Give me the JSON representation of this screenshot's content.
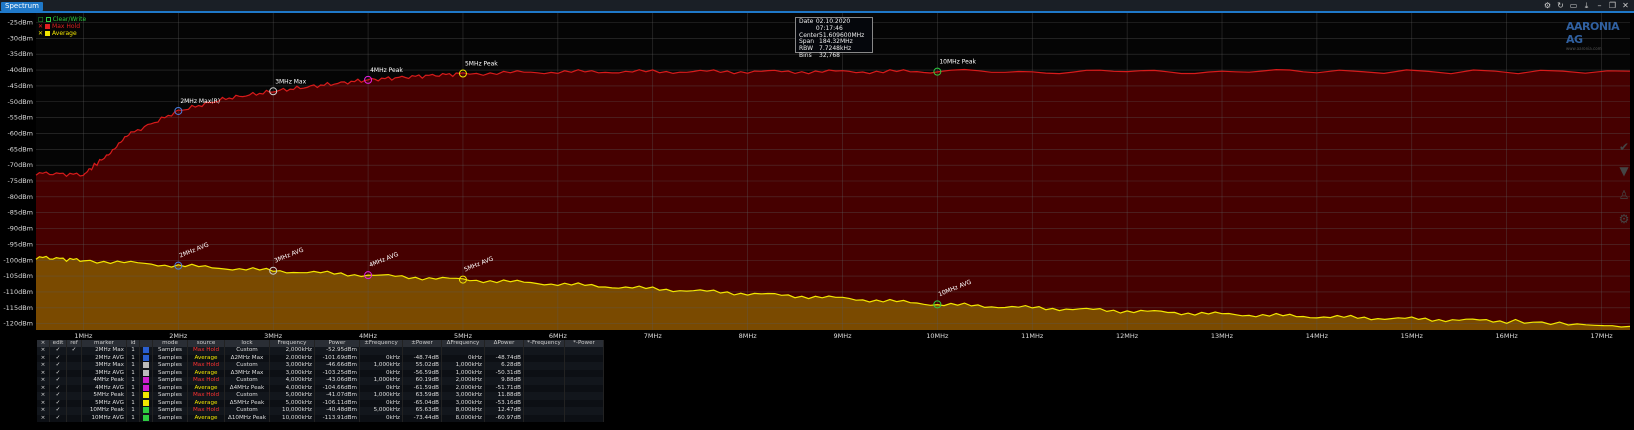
{
  "window": {
    "tab": "Spectrum",
    "icons": [
      "gear-icon",
      "refresh-icon",
      "layout-icon",
      "download-icon",
      "minimize-icon",
      "restore-icon",
      "close-icon"
    ]
  },
  "colors": {
    "maxhold": "#d81b1b",
    "average": "#f2e600",
    "bg_red": "#4a0000",
    "bg_avg": "#7a4a00",
    "accent": "#1f78c8"
  },
  "legend": [
    {
      "label": "Clear/Write",
      "color": "#2ecc40",
      "mark": "□"
    },
    {
      "label": "Max Hold",
      "color": "#e02020",
      "mark": "✕"
    },
    {
      "label": "Average",
      "color": "#f2e600",
      "mark": "✕"
    }
  ],
  "info": {
    "rows": [
      {
        "k": "Date",
        "v": "02.10.2020 07:17:46"
      },
      {
        "k": "Center",
        "v": "51.609600MHz"
      },
      {
        "k": "Span",
        "v": "184.32MHz"
      },
      {
        "k": "RBW",
        "v": "7.7248kHz"
      },
      {
        "k": "Bins",
        "v": "32,768"
      }
    ]
  },
  "logo": {
    "text": "AARONIA AG",
    "sub": "www.aaronia.com"
  },
  "chart_data": {
    "type": "line",
    "ylim": [
      -122,
      -22
    ],
    "xlim": [
      0.5,
      17.3
    ],
    "y_ticks": [
      "-25dBm",
      "-30dBm",
      "-35dBm",
      "-40dBm",
      "-45dBm",
      "-50dBm",
      "-55dBm",
      "-60dBm",
      "-65dBm",
      "-70dBm",
      "-75dBm",
      "-80dBm",
      "-85dBm",
      "-90dBm",
      "-95dBm",
      "-100dBm",
      "-105dBm",
      "-110dBm",
      "-115dBm",
      "-120dBm"
    ],
    "y_tick_values": [
      -25,
      -30,
      -35,
      -40,
      -45,
      -50,
      -55,
      -60,
      -65,
      -70,
      -75,
      -80,
      -85,
      -90,
      -95,
      -100,
      -105,
      -110,
      -115,
      -120
    ],
    "x_ticks": [
      "1MHz",
      "2MHz",
      "3MHz",
      "4MHz",
      "5MHz",
      "6MHz",
      "7MHz",
      "8MHz",
      "9MHz",
      "10MHz",
      "11MHz",
      "12MHz",
      "13MHz",
      "14MHz",
      "15MHz",
      "16MHz",
      "17MHz"
    ],
    "x_tick_values": [
      1,
      2,
      3,
      4,
      5,
      6,
      7,
      8,
      9,
      10,
      11,
      12,
      13,
      14,
      15,
      16,
      17
    ],
    "series": [
      {
        "name": "Max Hold",
        "x": [
          0.5,
          1.0,
          1.2,
          1.5,
          2.0,
          2.5,
          3.0,
          3.5,
          4.0,
          4.5,
          5.0,
          6.0,
          7.0,
          8.0,
          9.0,
          10.0,
          12.0,
          14.0,
          17.3
        ],
        "y": [
          -72.5,
          -73,
          -68,
          -60,
          -52.9,
          -49,
          -46.7,
          -44.8,
          -43.1,
          -42,
          -41.1,
          -40.6,
          -40.5,
          -40.5,
          -40.5,
          -40.5,
          -40.5,
          -40.5,
          -40.5
        ]
      },
      {
        "name": "Average",
        "x": [
          0.5,
          1.0,
          2.0,
          3.0,
          4.0,
          5.0,
          6.0,
          7.0,
          8.0,
          9.0,
          10.0,
          11.0,
          12.0,
          13.0,
          14.0,
          15.0,
          16.0,
          17.3
        ],
        "y": [
          -99,
          -100,
          -101.7,
          -103.3,
          -104.7,
          -106.1,
          -107.5,
          -109,
          -110.5,
          -112,
          -113.9,
          -115,
          -116,
          -117,
          -117.8,
          -118.5,
          -119.2,
          -121
        ]
      }
    ],
    "markers": [
      {
        "label": "2MHz Max(R)",
        "x": 2.0,
        "y": -52.9,
        "color": "#4a7fe0"
      },
      {
        "label": "3MHz  Max",
        "x": 3.0,
        "y": -46.7,
        "color": "#cccccc"
      },
      {
        "label": "4MHz Peak",
        "x": 4.0,
        "y": -43.1,
        "color": "#e020e0"
      },
      {
        "label": "5MHz Peak",
        "x": 5.0,
        "y": -41.1,
        "color": "#f2e600"
      },
      {
        "label": "10MHz Peak",
        "x": 10.0,
        "y": -40.5,
        "color": "#2ecc40"
      },
      {
        "label": "2MHz AVG",
        "x": 2.0,
        "y": -101.7,
        "color": "#4a7fe0"
      },
      {
        "label": "3MHz AVG",
        "x": 3.0,
        "y": -103.3,
        "color": "#cccccc"
      },
      {
        "label": "4MHz AVG",
        "x": 4.0,
        "y": -104.7,
        "color": "#e020e0"
      },
      {
        "label": "5MHz AVG",
        "x": 5.0,
        "y": -106.1,
        "color": "#f2e600"
      },
      {
        "label": "10MHz AVG",
        "x": 10.0,
        "y": -113.9,
        "color": "#2ecc40"
      }
    ]
  },
  "table": {
    "headers": [
      "×",
      "edit",
      "ref",
      "marker",
      "id",
      "",
      "mode",
      "source",
      "lock",
      "Frequency",
      "Power",
      "±Frequency",
      "±Power",
      "ΔFrequency",
      "ΔPower",
      "*-Frequency",
      "*-Power"
    ],
    "rows": [
      [
        "×",
        "✓",
        "✓",
        "2MHz Max",
        "1",
        "#2a5fd0",
        "Samples",
        "Max Hold",
        "Custom",
        "2,000kHz",
        "-52.95dBm",
        "",
        "",
        "",
        "",
        "",
        ""
      ],
      [
        "×",
        "✓",
        "",
        "2MHz AVG",
        "1",
        "#2a5fd0",
        "Samples",
        "Average",
        "Δ2MHz Max",
        "2,000kHz",
        "-101.69dBm",
        "0kHz",
        "-48.74dB",
        "0kHz",
        "-48.74dB",
        "",
        ""
      ],
      [
        "×",
        "✓",
        "",
        "3MHz Max",
        "1",
        "#bbbbbb",
        "Samples",
        "Max Hold",
        "Custom",
        "3,000kHz",
        "-46.66dBm",
        "1,000kHz",
        "55.02dB",
        "1,000kHz",
        "6.28dB",
        "",
        ""
      ],
      [
        "×",
        "✓",
        "",
        "3MHz AVG",
        "1",
        "#bbbbbb",
        "Samples",
        "Average",
        "Δ3MHz Max",
        "3,000kHz",
        "-103.25dBm",
        "0kHz",
        "-56.59dB",
        "1,000kHz",
        "-50.31dB",
        "",
        ""
      ],
      [
        "×",
        "✓",
        "",
        "4MHz Peak",
        "1",
        "#d020d0",
        "Samples",
        "Max Hold",
        "Custom",
        "4,000kHz",
        "-43.06dBm",
        "1,000kHz",
        "60.19dB",
        "2,000kHz",
        "9.88dB",
        "",
        ""
      ],
      [
        "×",
        "✓",
        "",
        "4MHz AVG",
        "1",
        "#d020d0",
        "Samples",
        "Average",
        "Δ4MHz Peak",
        "4,000kHz",
        "-104.66dBm",
        "0kHz",
        "-61.59dB",
        "2,000kHz",
        "-51.71dB",
        "",
        ""
      ],
      [
        "×",
        "✓",
        "",
        "5MHz Peak",
        "1",
        "#f2e600",
        "Samples",
        "Max Hold",
        "Custom",
        "5,000kHz",
        "-41.07dBm",
        "1,000kHz",
        "63.59dB",
        "3,000kHz",
        "11.88dB",
        "",
        ""
      ],
      [
        "×",
        "✓",
        "",
        "5MHz AVG",
        "1",
        "#f2e600",
        "Samples",
        "Average",
        "Δ5MHz Peak",
        "5,000kHz",
        "-106.11dBm",
        "0kHz",
        "-65.04dB",
        "3,000kHz",
        "-53.16dB",
        "",
        ""
      ],
      [
        "×",
        "✓",
        "",
        "10MHz Peak",
        "1",
        "#2ecc40",
        "Samples",
        "Max Hold",
        "Custom",
        "10,000kHz",
        "-40.48dBm",
        "5,000kHz",
        "65.63dB",
        "8,000kHz",
        "12.47dB",
        "",
        ""
      ],
      [
        "×",
        "✓",
        "",
        "10MHz AVG",
        "1",
        "#2ecc40",
        "Samples",
        "Average",
        "Δ10MHz Peak",
        "10,000kHz",
        "-113.91dBm",
        "0kHz",
        "-73.44dB",
        "8,000kHz",
        "-60.97dB",
        "",
        ""
      ]
    ]
  }
}
